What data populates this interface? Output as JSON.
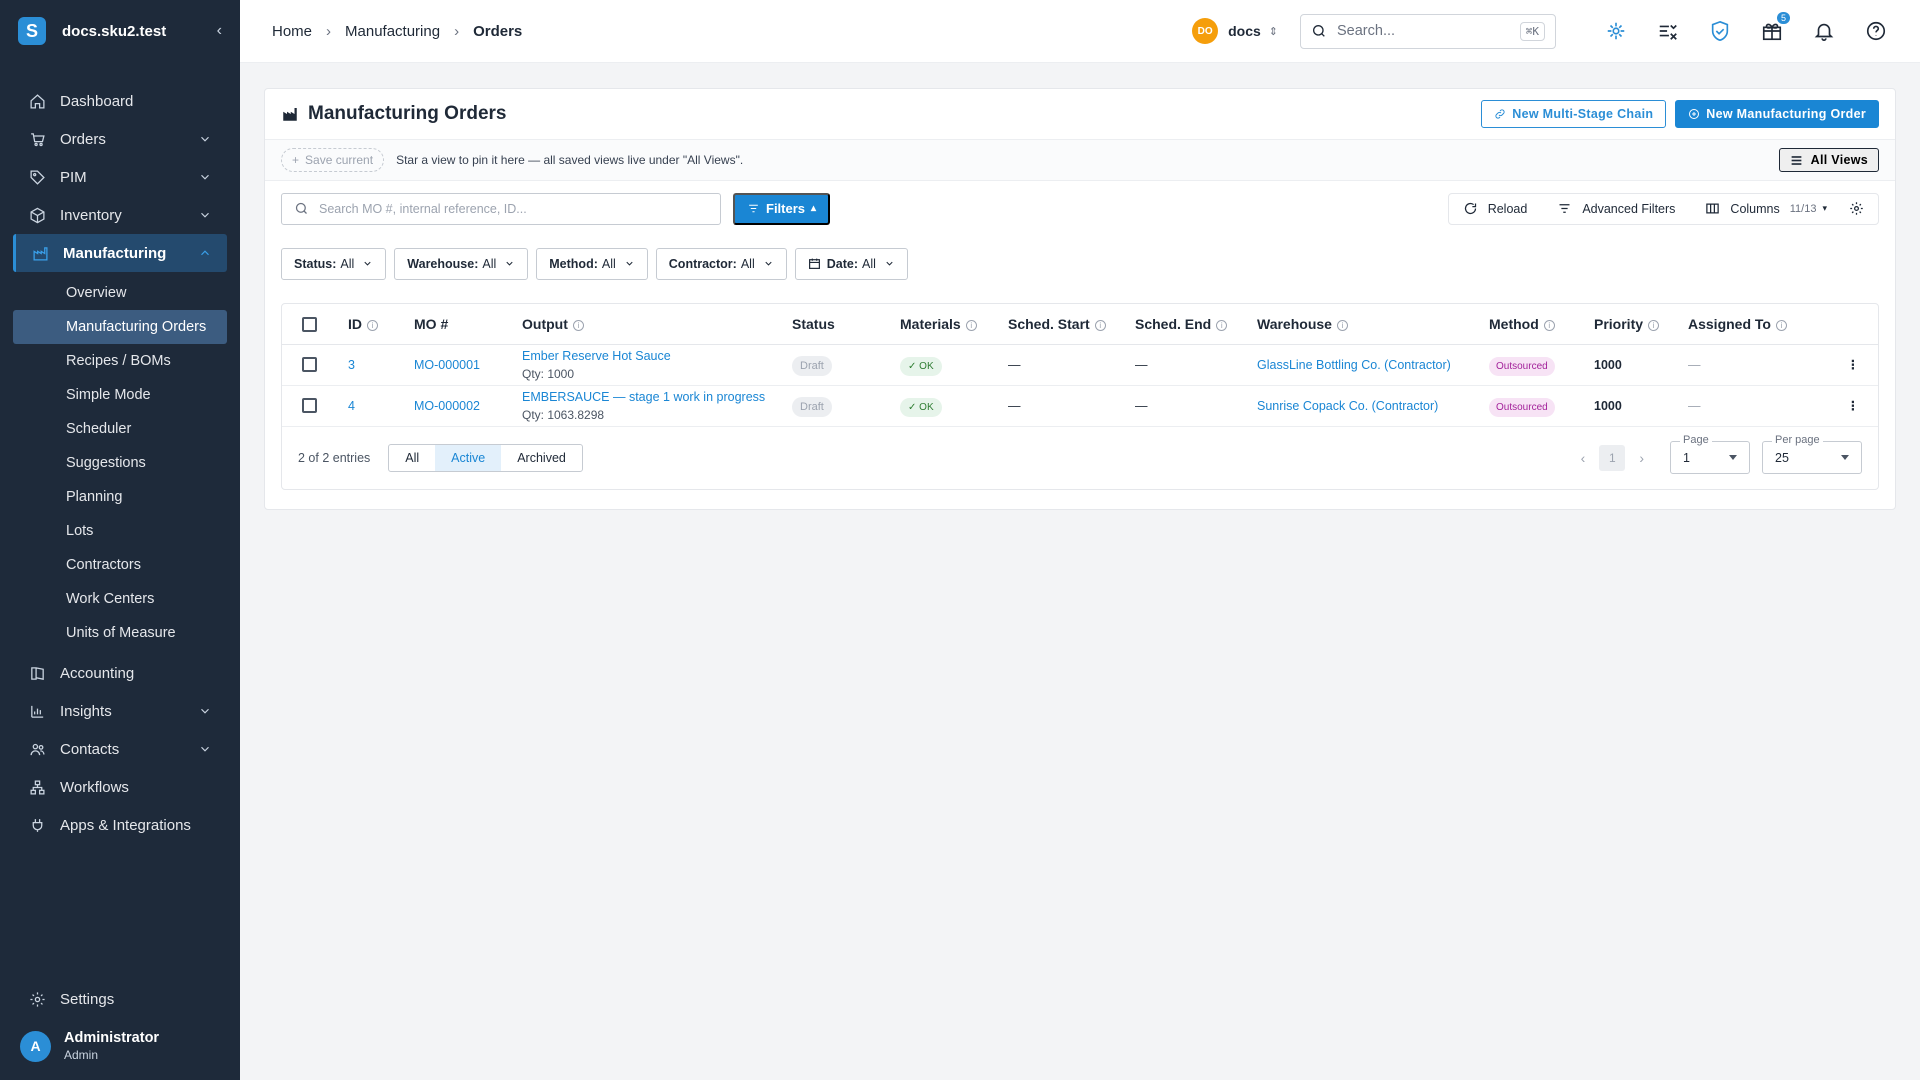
{
  "app": {
    "name": "docs.sku2.test",
    "logo_letter": "S",
    "accent": "#2b8ed6"
  },
  "sidebar": {
    "items": [
      {
        "label": "Dashboard"
      },
      {
        "label": "Orders"
      },
      {
        "label": "PIM"
      },
      {
        "label": "Inventory"
      },
      {
        "label": "Manufacturing"
      },
      {
        "label": "Accounting"
      },
      {
        "label": "Insights"
      },
      {
        "label": "Contacts"
      },
      {
        "label": "Workflows"
      },
      {
        "label": "Apps & Integrations"
      }
    ],
    "manufacturing_sub": [
      "Overview",
      "Manufacturing Orders",
      "Recipes / BOMs",
      "Simple Mode",
      "Scheduler",
      "Suggestions",
      "Planning",
      "Lots",
      "Contractors",
      "Work Centers",
      "Units of Measure"
    ],
    "settings_label": "Settings",
    "user": {
      "initial": "A",
      "name": "Administrator",
      "role": "Admin"
    }
  },
  "topbar": {
    "breadcrumb": [
      "Home",
      "Manufacturing",
      "Orders"
    ],
    "tenant_badge": "DO",
    "tenant_name": "docs",
    "search_placeholder": "Search...",
    "search_kbd": "⌘K",
    "gift_badge": "5"
  },
  "page": {
    "title": "Manufacturing Orders",
    "btn_chain": "New Multi-Stage Chain",
    "btn_new": "New Manufacturing Order",
    "save_current": "Save current",
    "views_hint": "Star a view to pin it here — all saved views live under \"All Views\".",
    "all_views": "All Views",
    "table_search_placeholder": "Search MO #, internal reference, ID...",
    "filters": "Filters",
    "reload": "Reload",
    "advanced_filters": "Advanced Filters",
    "columns": "Columns",
    "columns_count": "11/13",
    "chips": [
      {
        "label": "Status:",
        "value": "All"
      },
      {
        "label": "Warehouse:",
        "value": "All"
      },
      {
        "label": "Method:",
        "value": "All"
      },
      {
        "label": "Contractor:",
        "value": "All"
      },
      {
        "label": "Date:",
        "value": "All"
      }
    ]
  },
  "table": {
    "headers": [
      "ID",
      "MO #",
      "Output",
      "Status",
      "Materials",
      "Sched. Start",
      "Sched. End",
      "Warehouse",
      "Method",
      "Priority",
      "Assigned To"
    ],
    "rows": [
      {
        "id": "3",
        "mo": "MO-000001",
        "output": "Ember Reserve Hot Sauce",
        "qty": "Qty: 1000",
        "status": "Draft",
        "materials": "OK",
        "start": "—",
        "end": "—",
        "warehouse": "GlassLine Bottling Co. (Contractor)",
        "method": "Outsourced",
        "priority": "1000",
        "assigned": "—"
      },
      {
        "id": "4",
        "mo": "MO-000002",
        "output": "EMBERSAUCE — stage 1 work in progress",
        "qty": "Qty: 1063.8298",
        "status": "Draft",
        "materials": "OK",
        "start": "—",
        "end": "—",
        "warehouse": "Sunrise Copack Co. (Contractor)",
        "method": "Outsourced",
        "priority": "1000",
        "assigned": "—"
      }
    ],
    "entries": "2 of 2 entries",
    "segments": [
      "All",
      "Active",
      "Archived"
    ],
    "current_page": "1",
    "page_label": "Page",
    "page_value": "1",
    "per_page_label": "Per page",
    "per_page_value": "25"
  }
}
